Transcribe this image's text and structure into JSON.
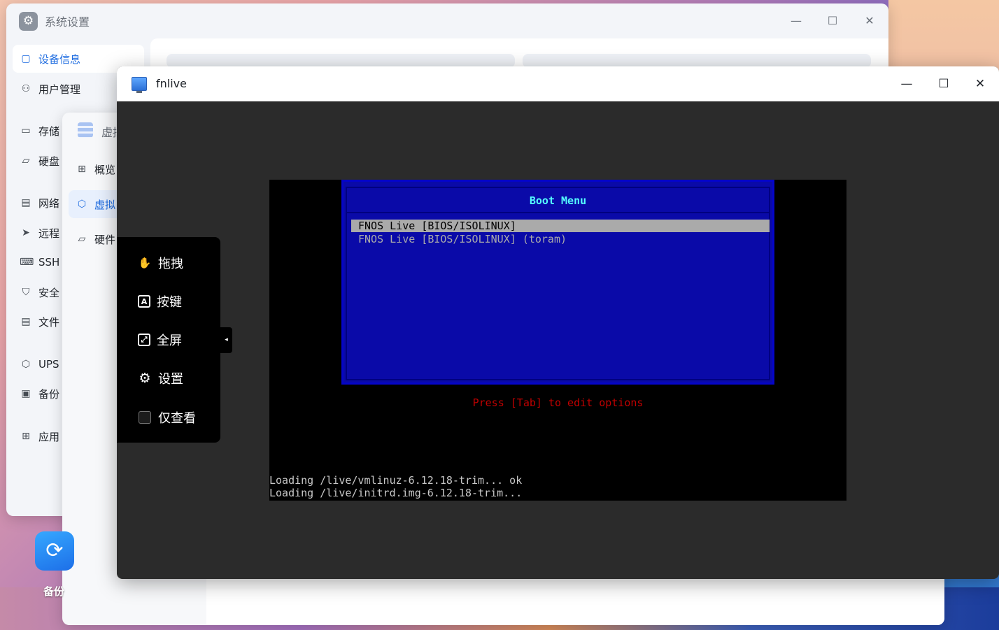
{
  "settings_window": {
    "title": "系统设置",
    "controls": {
      "minimize": "—",
      "maximize": "☐",
      "close": "✕"
    },
    "sidebar": [
      {
        "label": "设备信息",
        "icon": "device-info-icon",
        "glyph": "▢",
        "active": true
      },
      {
        "label": "用户管理",
        "icon": "user-icon",
        "glyph": "⚇"
      },
      {
        "label": "存储",
        "icon": "storage-icon",
        "glyph": "▭"
      },
      {
        "label": "硬盘",
        "icon": "disk-icon",
        "glyph": "▱"
      },
      {
        "label": "网络",
        "icon": "network-icon",
        "glyph": "▤"
      },
      {
        "label": "远程",
        "icon": "send-icon",
        "glyph": "➤"
      },
      {
        "label": "SSH",
        "icon": "terminal-icon",
        "glyph": "⌨"
      },
      {
        "label": "安全",
        "icon": "shield-icon",
        "glyph": "⛉"
      },
      {
        "label": "文件",
        "icon": "file-icon",
        "glyph": "▤"
      },
      {
        "label": "UPS",
        "icon": "ups-shield-icon",
        "glyph": "⬡"
      },
      {
        "label": "备份",
        "icon": "backup-icon",
        "glyph": "▣"
      },
      {
        "label": "应用",
        "icon": "apps-icon",
        "glyph": "⊞"
      }
    ]
  },
  "vm_window": {
    "title": "虚拟",
    "sidebar": [
      {
        "label": "概览",
        "icon": "grid-icon",
        "glyph": "⊞"
      },
      {
        "label": "虚拟",
        "icon": "cube-icon",
        "glyph": "⬡",
        "active": true
      },
      {
        "label": "硬件",
        "icon": "hardware-icon",
        "glyph": "▱"
      }
    ]
  },
  "desktop": {
    "backup_app_label": "备份",
    "backup_app_glyph": "⟳"
  },
  "fnlive_window": {
    "title": "fnlive",
    "controls": {
      "minimize": "—",
      "maximize": "☐",
      "close": "✕"
    }
  },
  "console": {
    "boot_menu_title": "Boot Menu",
    "entries": [
      {
        "label": "FNOS Live [BIOS/ISOLINUX]",
        "selected": true
      },
      {
        "label": "FNOS Live [BIOS/ISOLINUX] (toram)",
        "selected": false
      }
    ],
    "hint": "Press [Tab] to edit options",
    "log": [
      "Loading /live/vmlinuz-6.12.18-trim... ok",
      "Loading /live/initrd.img-6.12.18-trim..."
    ],
    "colors": {
      "menu_bg": "#0a0aa8",
      "title": "#55ffff",
      "hint": "#c00000",
      "selected_bg": "#aaaaaa"
    }
  },
  "toolbar": {
    "items": [
      {
        "label": "拖拽",
        "icon": "hand-drag-icon",
        "glyph": "✋"
      },
      {
        "label": "按键",
        "icon": "keyboard-key-icon",
        "glyph": "A"
      },
      {
        "label": "全屏",
        "icon": "fullscreen-icon",
        "glyph": "⤢"
      },
      {
        "label": "设置",
        "icon": "gear-icon",
        "glyph": "⚙"
      },
      {
        "label": "仅查看",
        "icon": "checkbox-icon",
        "glyph": "",
        "checked": false
      }
    ],
    "collapse_glyph": "◂"
  }
}
